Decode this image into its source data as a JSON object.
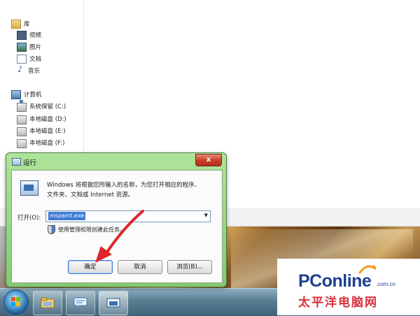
{
  "nav": {
    "library": "库",
    "video": "视频",
    "pictures": "图片",
    "documents": "文档",
    "music": "音乐",
    "computer": "计算机",
    "drives": [
      "系统保留 (C:)",
      "本地磁盘 (D:)",
      "本地磁盘 (E:)",
      "本地磁盘 (F:)"
    ]
  },
  "dialog": {
    "title": "运行",
    "close": "x",
    "description_line1": "Windows 将根据您所输入的名称，为您打开相应的程序、",
    "description_line2": "文件夹、文档或 Internet 资源。",
    "open_label": "打开(O):",
    "open_value": "mspaint.exe",
    "admin_note": "使用管理权限创建此任务。",
    "ok": "确定",
    "cancel": "取消",
    "browse": "浏览(B)..."
  },
  "watermark": {
    "main": "PConline",
    "domain": ".com.cn",
    "sub": "太平洋电脑网"
  },
  "colors": {
    "dialog_frame": "#86c873",
    "logo_blue": "#1f3f8f",
    "logo_red": "#d8323c",
    "arrow_red": "#e0262a"
  }
}
